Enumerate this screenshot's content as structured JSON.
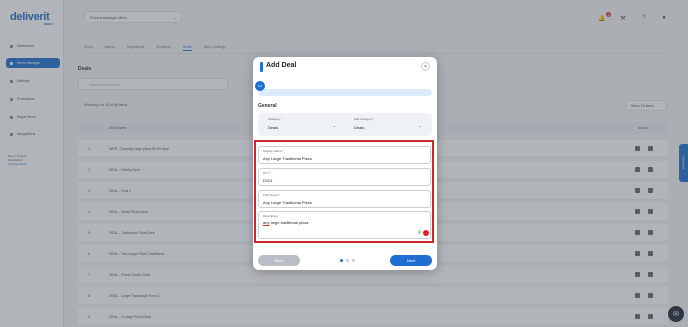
{
  "app": {
    "logo": "deliverit",
    "logo_sub": "MENU"
  },
  "sidebar": {
    "items": [
      {
        "label": "Dashboard",
        "active": false
      },
      {
        "label": "Menu Manager",
        "active": true
      },
      {
        "label": "Settings",
        "active": false
      },
      {
        "label": "Promotions",
        "active": false
      },
      {
        "label": "Sugar Items",
        "active": false
      },
      {
        "label": "Integrations",
        "active": false
      }
    ],
    "store_meta": {
      "line1": "Menu Version",
      "line2": "Deal Editor",
      "link": "Change Store"
    }
  },
  "header": {
    "store_select": "Pizzeria Manager Menu",
    "notification_count": "3"
  },
  "tabs": [
    "Items",
    "Menus",
    "Ingredients",
    "Modifiers",
    "Deals",
    "Menu Settings"
  ],
  "active_tab": "Deals",
  "page": {
    "title": "Deals",
    "search_placeholder": "Search Name/Code",
    "showing": "Showing 1 to 10 of 98 items",
    "show_button": "Show 10 items",
    "col_name": "Deal Name",
    "col_action": "Action",
    "rows": [
      {
        "num": "1",
        "name": "WEB - Tuesday large pizza $9.99 deal"
      },
      {
        "num": "2",
        "name": "DEAL - Family Deal"
      },
      {
        "num": "3",
        "name": "DEAL - Deal 1"
      },
      {
        "num": "4",
        "name": "DEAL - Small Pizza Deal"
      },
      {
        "num": "5",
        "name": "DEAL - Traditional Pizza Deal"
      },
      {
        "num": "6",
        "name": "DEAL - Two Large Pizza Traditional"
      },
      {
        "num": "7",
        "name": "DEAL - Pizza Combo Deal"
      },
      {
        "num": "8",
        "name": "DEAL - Large Traditional Pizza 2"
      },
      {
        "num": "9",
        "name": "DEAL - 2 Large Pizza Deal"
      }
    ]
  },
  "feedback_label": "Feedback",
  "modal": {
    "title": "Add Deal",
    "close": "×",
    "step_label": "1/3",
    "progress": 0.05,
    "section_title": "General",
    "category_label": "Category *",
    "category_value": "Deals",
    "subcategory_label": "Sub Category *",
    "subcategory_value": "Deals",
    "display_name_label": "Display Name *",
    "display_name_value": "Any Large Traditional Pizza",
    "plu_label": "PLU *",
    "plu_value": "D101",
    "print_name_label": "Print Name *",
    "print_name_value": "Any Large Traditional Pizza",
    "description_label": "Description",
    "description_first": "any",
    "description_rest": " large traditional pizza",
    "back_label": "Back",
    "next_label": "Next"
  },
  "colors": {
    "primary": "#1e6fd1",
    "highlight": "#d0262b",
    "overlay": "#464c56"
  }
}
